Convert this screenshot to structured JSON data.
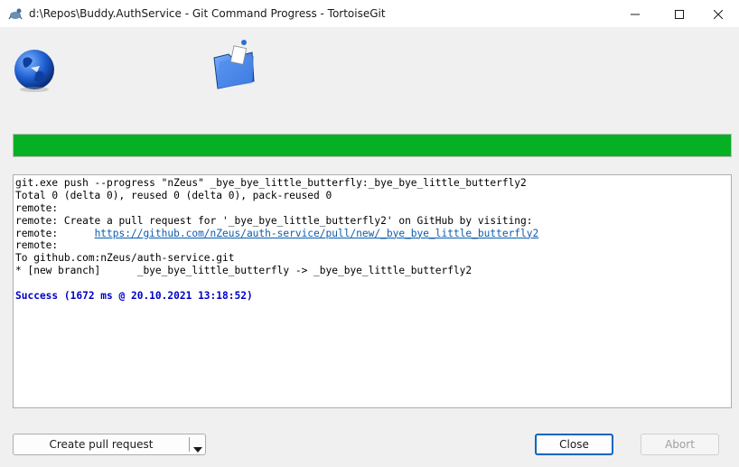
{
  "window": {
    "title": "d:\\Repos\\Buddy.AuthService - Git Command Progress - TortoiseGit",
    "controls": [
      "minimize-icon",
      "maximize-icon",
      "close-icon"
    ]
  },
  "icons": {
    "app": "tortoisegit-icon",
    "remote": "globe-icon",
    "local": "folder-icon"
  },
  "progress": {
    "value": 1.0,
    "color": "#06b025"
  },
  "log": {
    "lines": [
      "git.exe push --progress \"nZeus\" _bye_bye_little_butterfly:_bye_bye_little_butterfly2",
      "Total 0 (delta 0), reused 0 (delta 0), pack-reused 0",
      "remote:",
      "remote: Create a pull request for '_bye_bye_little_butterfly2' on GitHub by visiting:",
      "remote:      ",
      "remote:",
      "To github.com:nZeus/auth-service.git",
      "* [new branch]      _bye_bye_little_butterfly -> _bye_bye_little_butterfly2",
      "",
      "Success (1672 ms @ 20.10.2021 13:18:52)"
    ],
    "link": "https://github.com/nZeus/auth-service/pull/new/_bye_bye_little_butterfly2",
    "success_color": "#0000c8",
    "link_color": "#0b5cad"
  },
  "buttons": {
    "create_pull_request": "Create pull request",
    "close": "Close",
    "abort": "Abort"
  }
}
